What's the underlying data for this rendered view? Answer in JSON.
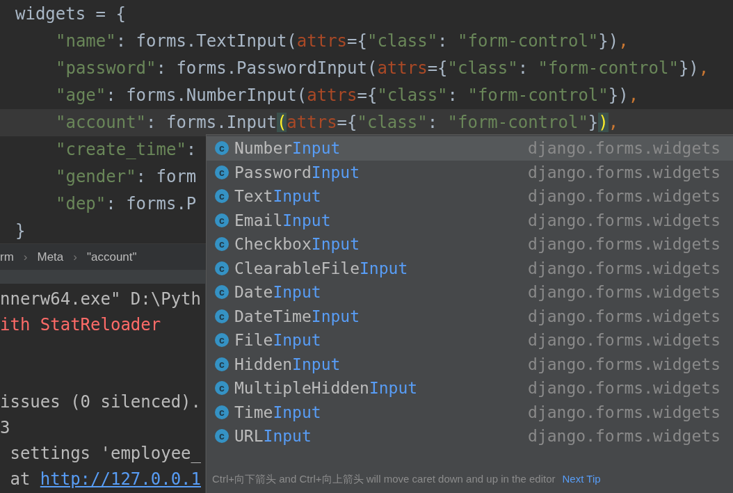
{
  "editor": {
    "lines": [
      {
        "current": false,
        "segments": [
          {
            "kind": "plain",
            "text": "widgets = {"
          }
        ],
        "children": [
          {
            "current": false,
            "segments": [
              {
                "kind": "string",
                "text": "\"name\""
              },
              {
                "kind": "plain",
                "text": ": forms.TextInput("
              },
              {
                "kind": "param",
                "text": "attrs"
              },
              {
                "kind": "plain",
                "text": "={"
              },
              {
                "kind": "string",
                "text": "\"class\""
              },
              {
                "kind": "plain",
                "text": ": "
              },
              {
                "kind": "string",
                "text": "\"form-control\""
              },
              {
                "kind": "plain",
                "text": "})"
              },
              {
                "kind": "comma",
                "text": ","
              }
            ]
          },
          {
            "current": false,
            "segments": [
              {
                "kind": "string",
                "text": "\"password\""
              },
              {
                "kind": "plain",
                "text": ": forms.PasswordInput("
              },
              {
                "kind": "param",
                "text": "attrs"
              },
              {
                "kind": "plain",
                "text": "={"
              },
              {
                "kind": "string",
                "text": "\"class\""
              },
              {
                "kind": "plain",
                "text": ": "
              },
              {
                "kind": "string",
                "text": "\"form-control\""
              },
              {
                "kind": "plain",
                "text": "})"
              },
              {
                "kind": "comma",
                "text": ","
              }
            ]
          },
          {
            "current": false,
            "segments": [
              {
                "kind": "string",
                "text": "\"age\""
              },
              {
                "kind": "plain",
                "text": ": forms.NumberInput("
              },
              {
                "kind": "param",
                "text": "attrs"
              },
              {
                "kind": "plain",
                "text": "={"
              },
              {
                "kind": "string",
                "text": "\"class\""
              },
              {
                "kind": "plain",
                "text": ": "
              },
              {
                "kind": "string",
                "text": "\"form-control\""
              },
              {
                "kind": "plain",
                "text": "})"
              },
              {
                "kind": "comma",
                "text": ","
              }
            ]
          },
          {
            "current": true,
            "segments": [
              {
                "kind": "string",
                "text": "\"account\""
              },
              {
                "kind": "plain",
                "text": ": forms.Input"
              },
              {
                "kind": "brace",
                "text": "("
              },
              {
                "kind": "param",
                "text": "attrs"
              },
              {
                "kind": "plain",
                "text": "={"
              },
              {
                "kind": "string",
                "text": "\"class\""
              },
              {
                "kind": "plain",
                "text": ": "
              },
              {
                "kind": "string",
                "text": "\"form-control\""
              },
              {
                "kind": "plain",
                "text": "}"
              },
              {
                "kind": "brace",
                "text": ")"
              },
              {
                "kind": "comma",
                "text": ","
              }
            ]
          },
          {
            "current": false,
            "segments": [
              {
                "kind": "string",
                "text": "\"create_time\""
              },
              {
                "kind": "plain",
                "text": ":"
              }
            ]
          },
          {
            "current": false,
            "segments": [
              {
                "kind": "string",
                "text": "\"gender\""
              },
              {
                "kind": "plain",
                "text": ": form"
              }
            ]
          },
          {
            "current": false,
            "segments": [
              {
                "kind": "string",
                "text": "\"dep\""
              },
              {
                "kind": "plain",
                "text": ": forms.P"
              }
            ]
          }
        ]
      },
      {
        "current": false,
        "segments": [
          {
            "kind": "plain",
            "text": "}"
          }
        ]
      }
    ]
  },
  "breadcrumbs": {
    "separator": "›",
    "items": [
      "rm",
      "Meta",
      "\"account\""
    ]
  },
  "console": {
    "lines": [
      {
        "segments": [
          {
            "kind": "plain",
            "text": "nnerw64.exe\" D:\\Pyth"
          }
        ]
      },
      {
        "segments": [
          {
            "kind": "error",
            "text": "ith StatReloader"
          }
        ]
      },
      {
        "segments": [
          {
            "kind": "plain",
            "text": "issues (0 silenced)."
          }
        ]
      },
      {
        "segments": [
          {
            "kind": "plain",
            "text": "3"
          }
        ]
      },
      {
        "segments": [
          {
            "kind": "plain",
            "text": " settings 'employee_"
          }
        ]
      },
      {
        "segments": [
          {
            "kind": "plain",
            "text": " at "
          },
          {
            "kind": "link",
            "text": "http://127.0.0.1"
          }
        ]
      }
    ]
  },
  "completion": {
    "items": [
      {
        "badge": "c",
        "prefix": "Number",
        "match": "Input",
        "type": "django.forms.widgets",
        "selected": true
      },
      {
        "badge": "c",
        "prefix": "Password",
        "match": "Input",
        "type": "django.forms.widgets",
        "selected": false
      },
      {
        "badge": "c",
        "prefix": "Text",
        "match": "Input",
        "type": "django.forms.widgets",
        "selected": false
      },
      {
        "badge": "c",
        "prefix": "Email",
        "match": "Input",
        "type": "django.forms.widgets",
        "selected": false
      },
      {
        "badge": "c",
        "prefix": "Checkbox",
        "match": "Input",
        "type": "django.forms.widgets",
        "selected": false
      },
      {
        "badge": "c",
        "prefix": "ClearableFile",
        "match": "Input",
        "type": "django.forms.widgets",
        "selected": false
      },
      {
        "badge": "c",
        "prefix": "Date",
        "match": "Input",
        "type": "django.forms.widgets",
        "selected": false
      },
      {
        "badge": "c",
        "prefix": "DateTime",
        "match": "Input",
        "type": "django.forms.widgets",
        "selected": false
      },
      {
        "badge": "c",
        "prefix": "File",
        "match": "Input",
        "type": "django.forms.widgets",
        "selected": false
      },
      {
        "badge": "c",
        "prefix": "Hidden",
        "match": "Input",
        "type": "django.forms.widgets",
        "selected": false
      },
      {
        "badge": "c",
        "prefix": "MultipleHidden",
        "match": "Input",
        "type": "django.forms.widgets",
        "selected": false
      },
      {
        "badge": "c",
        "prefix": "Time",
        "match": "Input",
        "type": "django.forms.widgets",
        "selected": false
      },
      {
        "badge": "c",
        "prefix": "URL",
        "match": "Input",
        "type": "django.forms.widgets",
        "selected": false
      }
    ],
    "hint": "Ctrl+向下箭头 and Ctrl+向上箭头 will move caret down and up in the editor",
    "next_tip": "Next Tip"
  }
}
